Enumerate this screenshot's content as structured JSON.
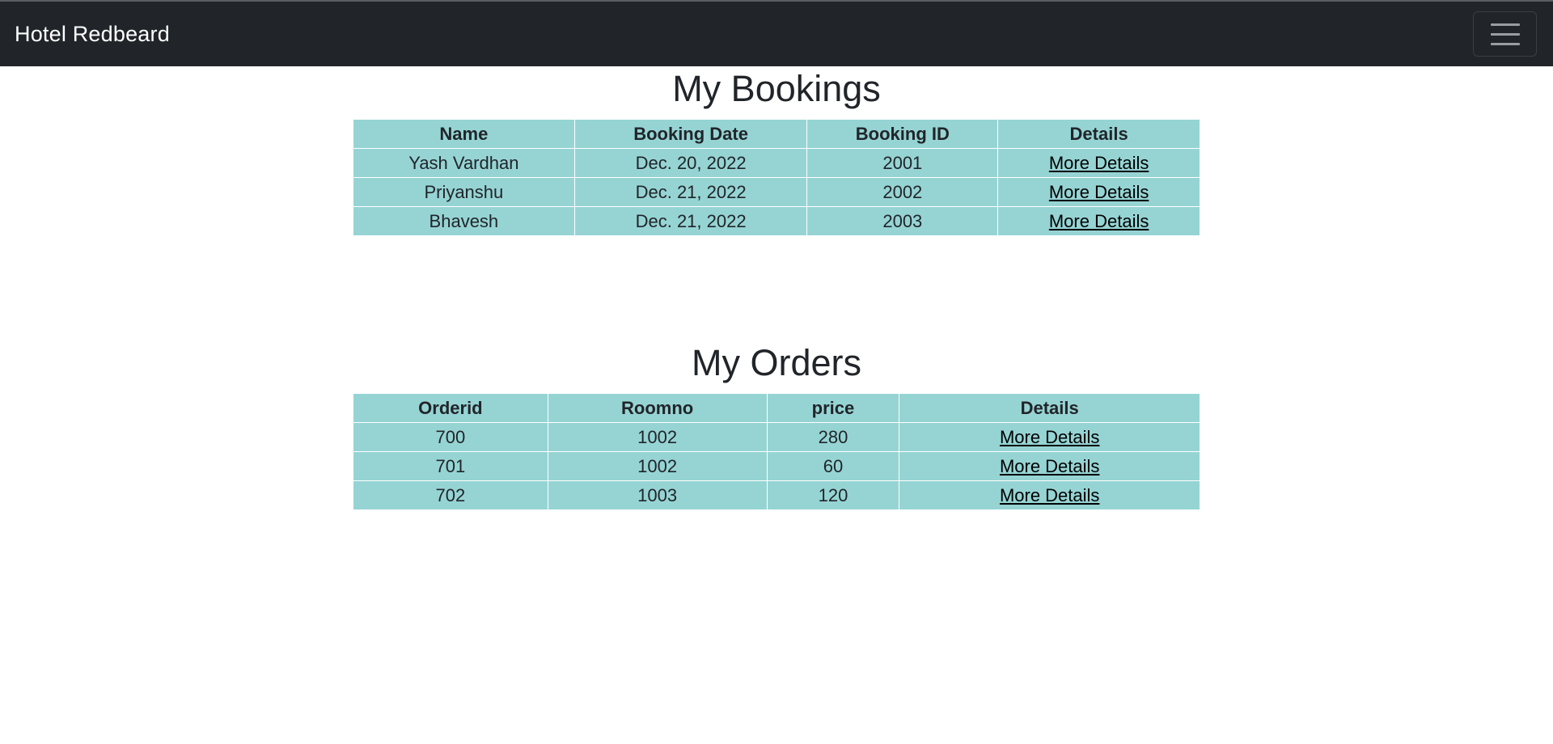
{
  "navbar": {
    "brand": "Hotel Redbeard",
    "toggler_icon": "hamburger-icon"
  },
  "bookings": {
    "title": "My Bookings",
    "columns": [
      "Name",
      "Booking Date",
      "Booking ID",
      "Details"
    ],
    "rows": [
      {
        "name": "Yash Vardhan",
        "date": "Dec. 20, 2022",
        "id": "2001",
        "details": "More Details"
      },
      {
        "name": "Priyanshu",
        "date": "Dec. 21, 2022",
        "id": "2002",
        "details": "More Details"
      },
      {
        "name": "Bhavesh",
        "date": "Dec. 21, 2022",
        "id": "2003",
        "details": "More Details"
      }
    ]
  },
  "orders": {
    "title": "My Orders",
    "columns": [
      "Orderid",
      "Roomno",
      "price",
      "Details"
    ],
    "rows": [
      {
        "orderid": "700",
        "roomno": "1002",
        "price": "280",
        "details": "More Details"
      },
      {
        "orderid": "701",
        "roomno": "1002",
        "price": "60",
        "details": "More Details"
      },
      {
        "orderid": "702",
        "roomno": "1003",
        "price": "120",
        "details": "More Details"
      }
    ]
  },
  "colors": {
    "navbar_bg": "#212529",
    "table_bg": "#96d4d4",
    "text": "#212529"
  }
}
